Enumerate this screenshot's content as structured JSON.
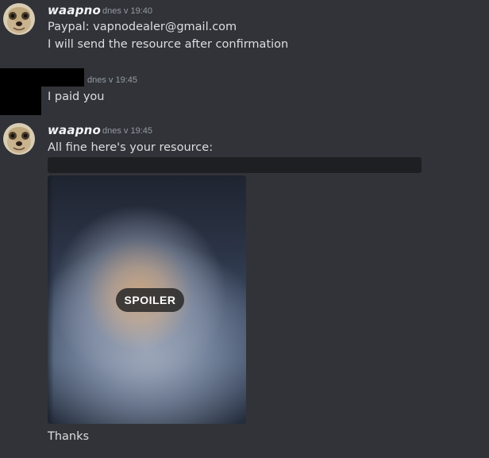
{
  "messages": [
    {
      "author": "waapno",
      "timestamp": "dnes v 19:40",
      "lines": [
        "Paypal: vapnodealer@gmail.com",
        "I will send the resource after confirmation"
      ]
    },
    {
      "author": "",
      "timestamp": "dnes v 19:45",
      "lines": [
        "I paid you"
      ]
    },
    {
      "author": "waapno",
      "timestamp": "dnes v 19:45",
      "lines": [
        "All fine here's your resource:"
      ],
      "image_spoiler_label": "SPOILER",
      "after_lines": [
        "Thanks"
      ]
    }
  ],
  "icons": {
    "avatar": "meerkat-avatar-icon",
    "redacted": "redacted-block"
  },
  "colors": {
    "background": "#313338",
    "text": "#dbdee1",
    "username": "#f2f3f5",
    "timestamp": "#949ba4",
    "spoiler_bar": "#1e1f22"
  }
}
